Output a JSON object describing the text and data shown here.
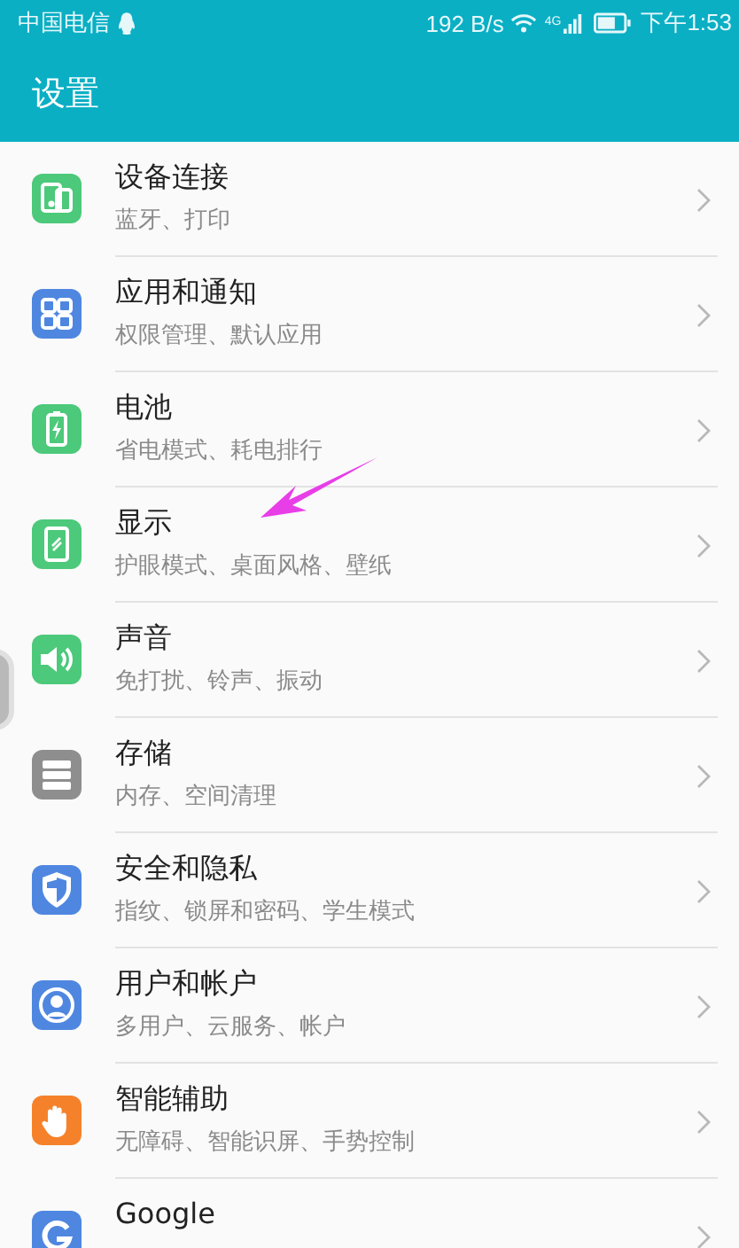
{
  "status_bar": {
    "carrier": "中国电信",
    "speed": "192 B/s",
    "network": "4G",
    "time": "下午1:53"
  },
  "header": {
    "title": "设置"
  },
  "items": [
    {
      "kind": "devices",
      "color": "#4cc97a",
      "title": "设备连接",
      "subtitle": "蓝牙、打印"
    },
    {
      "kind": "apps",
      "color": "#4f87e0",
      "title": "应用和通知",
      "subtitle": "权限管理、默认应用"
    },
    {
      "kind": "battery",
      "color": "#4cc97a",
      "title": "电池",
      "subtitle": "省电模式、耗电排行"
    },
    {
      "kind": "display",
      "color": "#4cc97a",
      "title": "显示",
      "subtitle": "护眼模式、桌面风格、壁纸"
    },
    {
      "kind": "sound",
      "color": "#4cc97a",
      "title": "声音",
      "subtitle": "免打扰、铃声、振动"
    },
    {
      "kind": "storage",
      "color": "#8e8e8e",
      "title": "存储",
      "subtitle": "内存、空间清理"
    },
    {
      "kind": "security",
      "color": "#4f87e0",
      "title": "安全和隐私",
      "subtitle": "指纹、锁屏和密码、学生模式"
    },
    {
      "kind": "user",
      "color": "#4f87e0",
      "title": "用户和帐户",
      "subtitle": "多用户、云服务、帐户"
    },
    {
      "kind": "assist",
      "color": "#f5822a",
      "title": "智能辅助",
      "subtitle": "无障碍、智能识屏、手势控制"
    },
    {
      "kind": "google",
      "color": "#4f87e0",
      "title": "Google"
    }
  ]
}
